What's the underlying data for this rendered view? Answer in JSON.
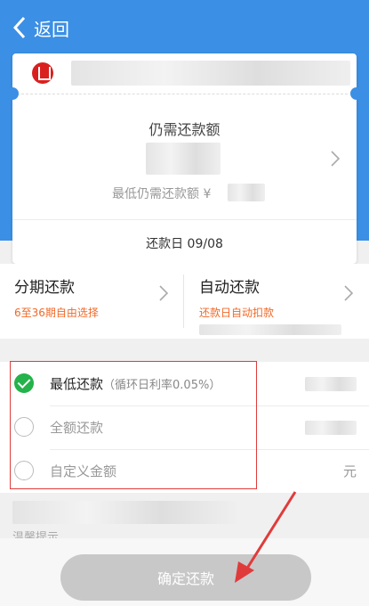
{
  "nav": {
    "back_label": "返回"
  },
  "bill": {
    "remaining_label": "仍需还款额",
    "min_label": "最低仍需还款额 ¥",
    "due_date": "还款日 09/08"
  },
  "options": {
    "installment": {
      "title": "分期还款",
      "subtitle": "6至36期自由选择"
    },
    "auto": {
      "title": "自动还款",
      "subtitle": "还款日自动扣款"
    }
  },
  "repay_choices": [
    {
      "label": "最低还款",
      "note": "（循环日利率0.05%）",
      "selected": true
    },
    {
      "label": "全额还款",
      "selected": false
    },
    {
      "label": "自定义金额",
      "unit": "元",
      "selected": false
    }
  ],
  "tip_label": "温馨提示",
  "confirm_label": "确定还款",
  "colors": {
    "primary": "#3b8fe4",
    "accent_orange": "#f06a28",
    "check_green": "#24b24a",
    "annotation_red": "#e03b3b"
  }
}
